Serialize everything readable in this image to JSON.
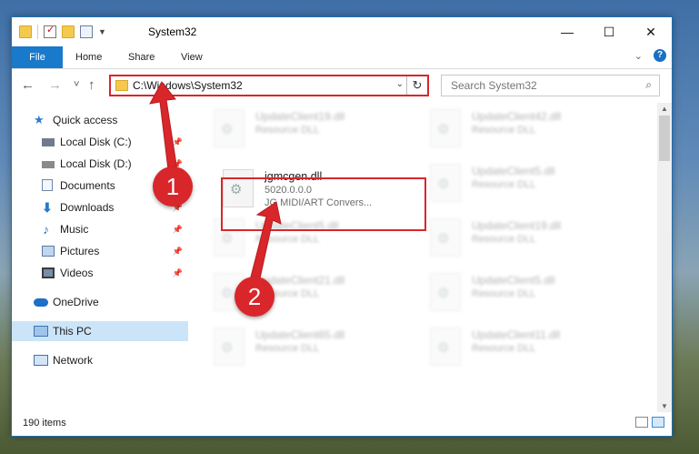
{
  "window": {
    "title": "System32"
  },
  "qat": {
    "icons": [
      "folder-icon",
      "properties-check-icon",
      "new-folder-icon",
      "customize-icon"
    ]
  },
  "window_controls": {
    "minimize": "—",
    "maximize": "☐",
    "close": "✕"
  },
  "ribbon": {
    "tabs": [
      "File",
      "Home",
      "Share",
      "View"
    ],
    "expand_icon": "chevron-down-icon",
    "help_label": "?"
  },
  "navigation": {
    "back": "←",
    "forward": "→",
    "recent": "˅",
    "up": "↑"
  },
  "address": {
    "path": "C:\\Windows\\System32",
    "dropdown": "⌄",
    "refresh": "↻"
  },
  "search": {
    "placeholder": "Search System32",
    "icon": "⌕"
  },
  "sidebar": {
    "items": [
      {
        "label": "Quick access",
        "icon": "star-icon"
      },
      {
        "label": "Local Disk (C:)",
        "icon": "drive-icon",
        "pinned": true
      },
      {
        "label": "Local Disk (D:)",
        "icon": "drive-icon",
        "pinned": true
      },
      {
        "label": "Documents",
        "icon": "documents-icon",
        "pinned": true
      },
      {
        "label": "Downloads",
        "icon": "download-icon",
        "pinned": true
      },
      {
        "label": "Music",
        "icon": "music-icon",
        "pinned": true
      },
      {
        "label": "Pictures",
        "icon": "pictures-icon",
        "pinned": true
      },
      {
        "label": "Videos",
        "icon": "videos-icon",
        "pinned": true
      },
      {
        "label": "OneDrive",
        "icon": "cloud-icon"
      },
      {
        "label": "This PC",
        "icon": "computer-icon",
        "selected": true
      },
      {
        "label": "Network",
        "icon": "network-icon"
      }
    ],
    "pin_glyph": "📌"
  },
  "files": [
    {
      "name": "UpdateClient19.dll",
      "desc": "Resource DLL"
    },
    {
      "name": "UpdateClient42.dll",
      "desc": "Resource DLL"
    },
    {
      "name": "jgmcgen.dll",
      "version": "5020.0.0.0",
      "desc": "JG MIDI/ART Convers..."
    },
    {
      "name": "UpdateClient5.dll",
      "desc": "Resource DLL"
    },
    {
      "name": "UpdateClient5.dll",
      "desc": "Resource DLL"
    },
    {
      "name": "UpdateClient19.dll",
      "desc": "Resource DLL"
    },
    {
      "name": "UpdateClient21.dll",
      "desc": "Resource DLL"
    },
    {
      "name": "UpdateClient5.dll",
      "desc": "Resource DLL"
    },
    {
      "name": "UpdateClient65.dll",
      "desc": "Resource DLL"
    },
    {
      "name": "UpdateClient11.dll",
      "desc": "Resource DLL"
    }
  ],
  "status": {
    "item_count": "190 items"
  },
  "annotations": {
    "marker1": "1",
    "marker2": "2",
    "accent": "#d9262b"
  },
  "colors": {
    "file_tab": "#1979ca",
    "selected_nav": "#cce4f7",
    "highlight": "#d9262b"
  }
}
